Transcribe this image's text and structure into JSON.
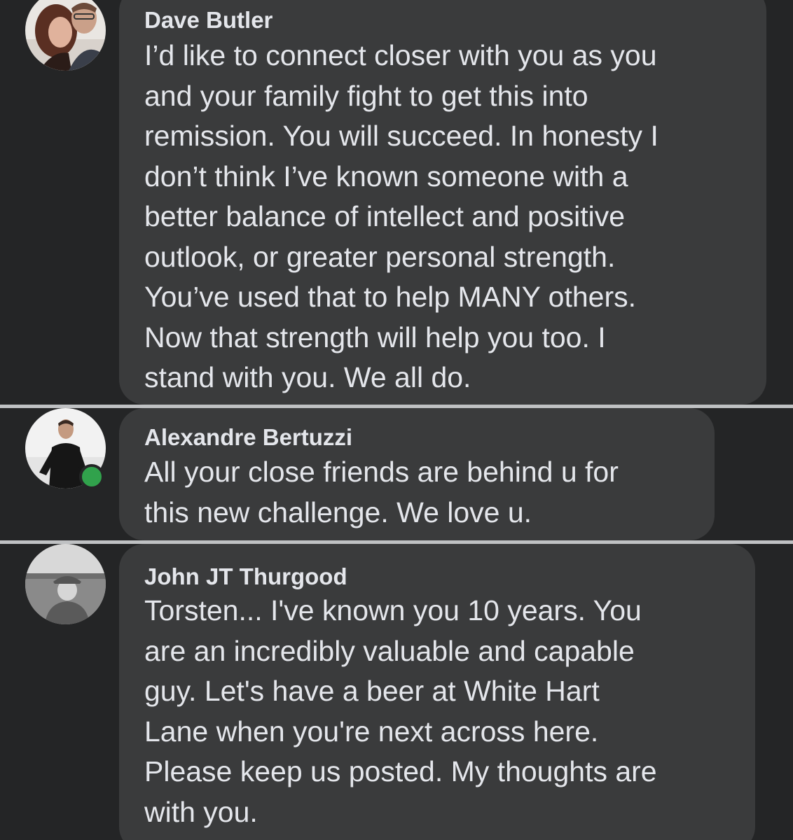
{
  "comments": [
    {
      "author": "Dave Butler",
      "lines": [
        "I’d like to connect closer with you as you",
        "and your family fight to get this into",
        "remission. You will succeed.  In honesty I",
        "don’t think I’ve known someone with a",
        "better balance of intellect and positive",
        "outlook, or greater personal strength.",
        "You’ve used that to help MANY others.",
        "Now that strength will help you too. I",
        "stand with you.  We all do."
      ],
      "avatar_icon": "couple-photo-avatar",
      "online": false
    },
    {
      "author": "Alexandre Bertuzzi",
      "lines": [
        "All your close friends are behind u for",
        "this new challenge. We love u."
      ],
      "avatar_icon": "man-speaking-avatar",
      "online": true
    },
    {
      "author": "John JT Thurgood",
      "lines": [
        "Torsten... I've known you 10 years. You",
        "are an incredibly valuable and capable",
        "guy. Let's have a beer at White Hart",
        "Lane when you're next across here.",
        "Please keep us posted. My thoughts are",
        "with you."
      ],
      "avatar_icon": "man-in-hat-field-avatar",
      "online": false
    }
  ],
  "colors": {
    "background": "#242526",
    "bubble": "#3a3b3c",
    "text": "#e4e6eb",
    "divider": "#bfc1c3",
    "online": "#31a24c"
  }
}
